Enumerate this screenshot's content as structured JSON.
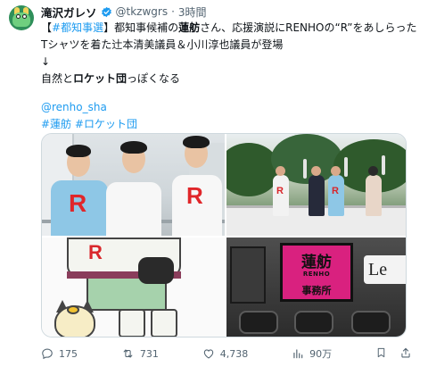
{
  "tweet": {
    "display_name": "滝沢ガレソ",
    "handle": "@tkzwgrs",
    "separator": "·",
    "time": "3時間",
    "body": {
      "line1": {
        "open_bracket": "【",
        "hashtag": "#都知事選",
        "close_bracket": "】",
        "pre": "都知事候補の",
        "bold": "蓮舫",
        "post": "さん、応援演説にRENHOの“R”をあしらった"
      },
      "line2": "Tシャツを着た辻本清美議員＆小川淳也議員が登場",
      "line3": "↓",
      "line4": {
        "pre": "自然と",
        "bold": "ロケット団",
        "post": "っぽくなる"
      },
      "mention": "@renho_sha",
      "hashtags": [
        "#蓮舫",
        "#ロケット団"
      ]
    },
    "media": {
      "photo1_letters": [
        "R",
        "R"
      ],
      "photo2_letters": [
        "R",
        "R"
      ],
      "anime_letter": "R",
      "elevator_panel": {
        "title": "蓮舫",
        "subtitle": "RENHO",
        "bottom": "事務所"
      },
      "elevator_label": "Le"
    },
    "actions": {
      "replies": "175",
      "reposts": "731",
      "likes": "4,738",
      "views": "90万"
    },
    "colors": {
      "link": "#1d9bf0",
      "muted": "#536471",
      "verified": "#1d9bf0"
    }
  }
}
